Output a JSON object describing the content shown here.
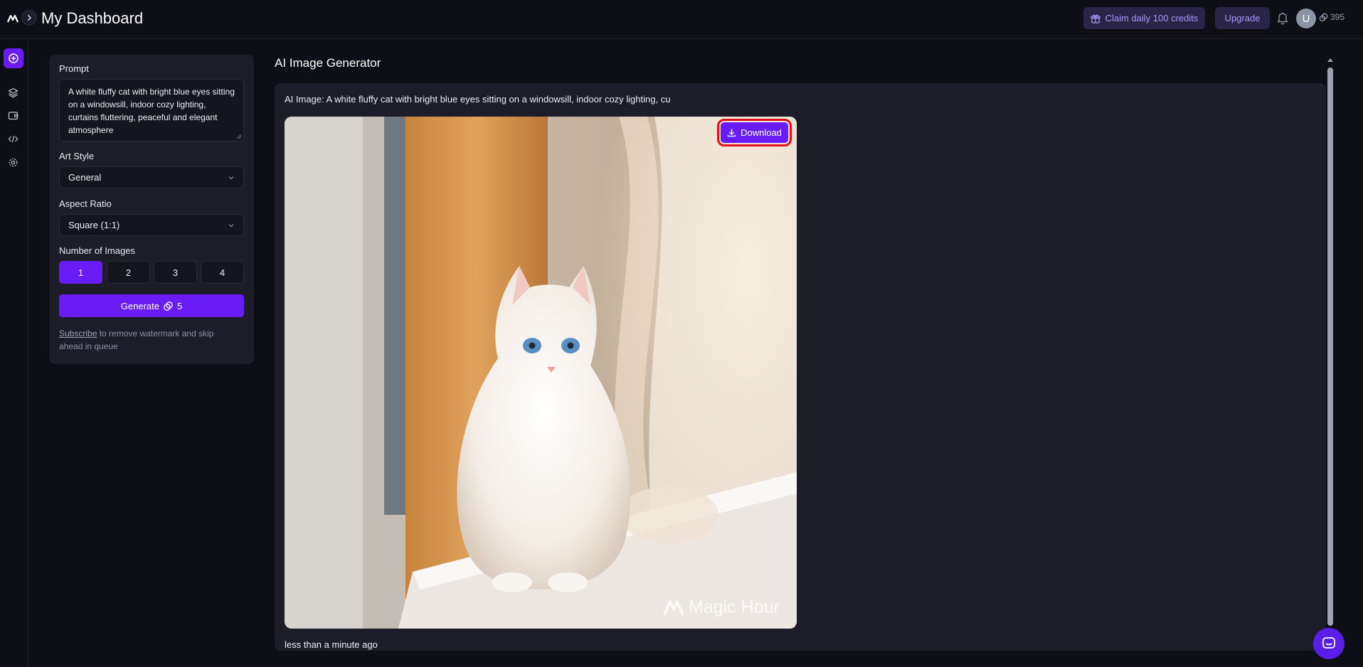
{
  "header": {
    "title": "My Dashboard",
    "claim_label": "Claim daily 100 credits",
    "upgrade_label": "Upgrade",
    "avatar_initial": "U",
    "credits": "395"
  },
  "rail": {
    "items": [
      "create-icon",
      "layers-icon",
      "wallet-icon",
      "code-icon",
      "settings-icon"
    ]
  },
  "form": {
    "prompt_label": "Prompt",
    "prompt_value": "A white fluffy cat with bright blue eyes sitting on a windowsill, indoor cozy lighting, curtains fluttering, peaceful and elegant atmosphere",
    "art_style_label": "Art Style",
    "art_style_value": "General",
    "aspect_ratio_label": "Aspect Ratio",
    "aspect_ratio_value": "Square (1:1)",
    "num_images_label": "Number of Images",
    "num_options": [
      "1",
      "2",
      "3",
      "4"
    ],
    "selected_num": "1",
    "generate_label": "Generate",
    "generate_cost": "5",
    "subscribe_link": "Subscribe",
    "subscribe_note": " to remove watermark and skip ahead in queue"
  },
  "main": {
    "title": "AI Image Generator",
    "caption": "AI Image: A white fluffy cat with bright blue eyes sitting on a windowsill, indoor cozy lighting, cu",
    "download_label": "Download",
    "watermark": "Magic Hour",
    "timestamp": "less than a minute ago"
  },
  "colors": {
    "accent": "#6a1cf6",
    "background": "#0d0e16",
    "panel": "#1c1d29",
    "highlight": "#e3101a"
  }
}
